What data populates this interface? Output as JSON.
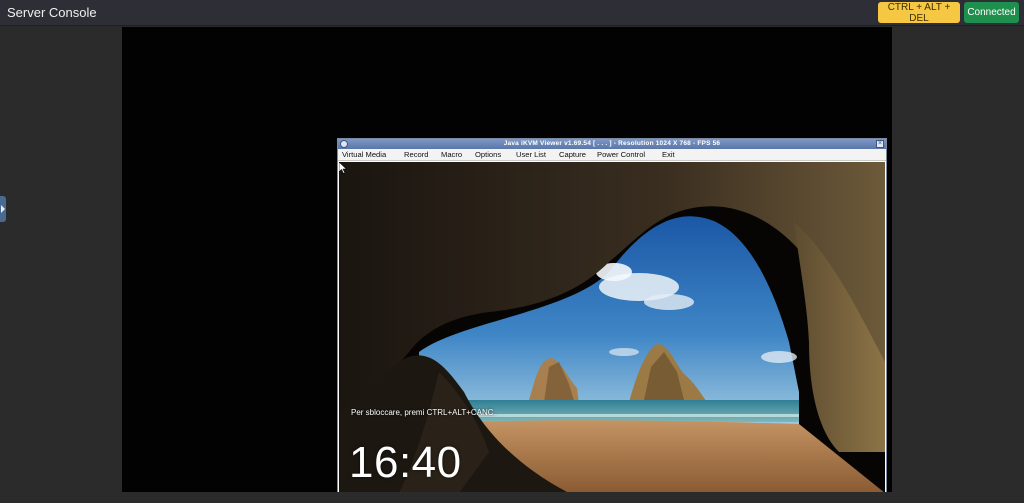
{
  "header": {
    "title": "Server Console",
    "cad_label": "CTRL + ALT + DEL",
    "status_label": "Connected"
  },
  "colors": {
    "cad_button": "#f5c742",
    "status_button": "#1f8f4e",
    "topbar": "#2e2f36"
  },
  "kvm": {
    "window_title": "Java iKVM Viewer v1.69.54 [ . . . ] - Resolution 1024 X 768 - FPS 56",
    "menu": [
      {
        "label": "Virtual Media"
      },
      {
        "label": "Record"
      },
      {
        "label": "Macro"
      },
      {
        "label": "Options"
      },
      {
        "label": "User List"
      },
      {
        "label": "Capture"
      },
      {
        "label": "Power Control"
      },
      {
        "label": "Exit"
      }
    ]
  },
  "lockscreen": {
    "unlock_hint": "Per sbloccare, premi CTRL+ALT+CANC.",
    "time": "16:40"
  }
}
